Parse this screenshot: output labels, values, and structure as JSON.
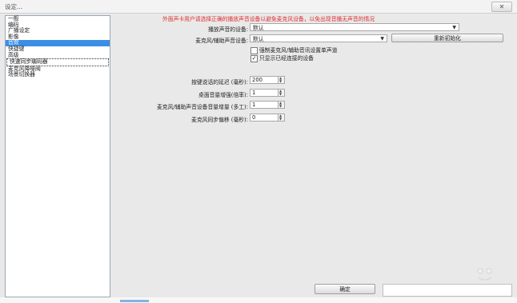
{
  "window": {
    "title": "设定..."
  },
  "sidebar": {
    "items": [
      {
        "label": "一般"
      },
      {
        "label": "编码"
      },
      {
        "label": "广播设定"
      },
      {
        "label": "影像"
      },
      {
        "label": "音效"
      },
      {
        "label": "快捷键"
      },
      {
        "label": "高级"
      },
      {
        "label": "快速同步编码器"
      },
      {
        "label": "麦克风降噪阀"
      },
      {
        "label": "场景切换器"
      }
    ],
    "selected_index": 4
  },
  "audio": {
    "warning": "外面声卡用户请选择正确的播放声音设备以避免麦克风设备，以免出现音播无声音的情况",
    "playback_label": "播放声音的设备:",
    "playback_value": "默认",
    "mic_label": "麦克风/辅助声音设备:",
    "mic_value": "默认",
    "reinit_button": "重新初始化",
    "force_mono_label": "强制麦克风/辅助音讯设置单声道",
    "force_mono_checked": false,
    "show_connected_label": "只显示已经连接的设备",
    "show_connected_checked": true,
    "ptt_delay_label": "按键说话的延迟 (毫秒):",
    "ptt_delay_value": "200",
    "desktop_boost_label": "桌面音量增强(倍率):",
    "desktop_boost_value": "1",
    "mic_boost_label": "麦克风/辅助声音设备音量增量 (多工):",
    "mic_boost_value": "1",
    "mic_offset_label": "麦克风同步偏移 (毫秒):",
    "mic_offset_value": "0"
  },
  "footer": {
    "ok_button": "确定"
  },
  "colors": {
    "selection": "#3a8ee6",
    "warning": "#e03030"
  }
}
